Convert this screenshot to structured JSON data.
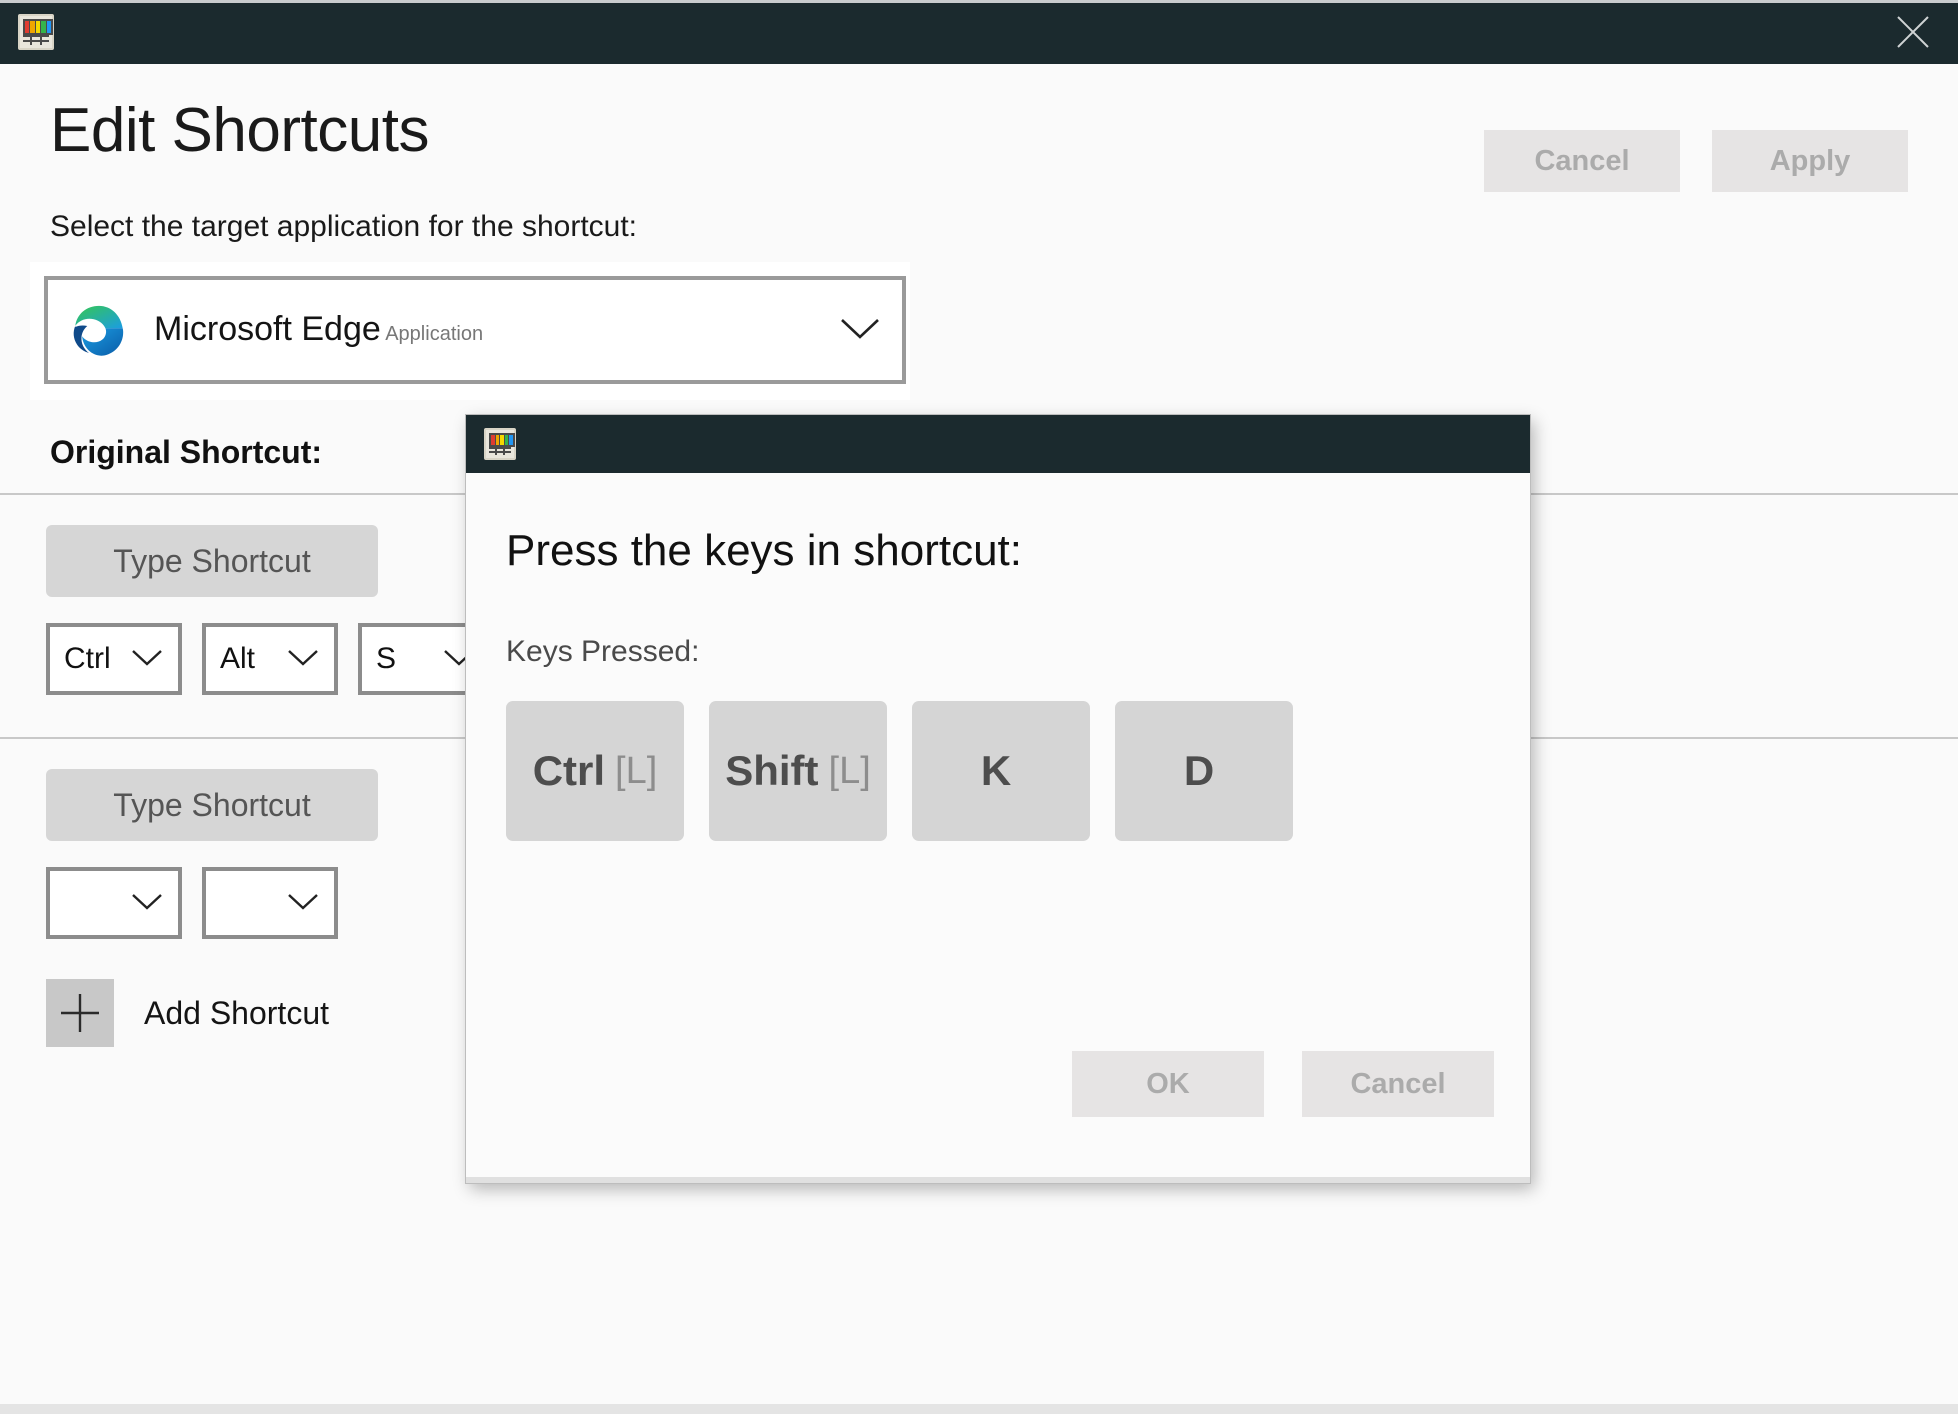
{
  "window": {
    "titlebar_color": "#1b2a2e",
    "app_icon": "powertoys-keyboard-manager-icon",
    "close_icon": "close-icon"
  },
  "header": {
    "title": "Edit Shortcuts",
    "cancel_label": "Cancel",
    "apply_label": "Apply",
    "buttons_disabled": true
  },
  "target_app": {
    "prompt": "Select the target application for the shortcut:",
    "selected_name": "Microsoft Edge",
    "selected_type": "Application",
    "icon": "microsoft-edge-icon",
    "chevron": "chevron-down-icon"
  },
  "shortcuts_section": {
    "heading": "Original Shortcut:"
  },
  "shortcut_rows": [
    {
      "type_shortcut_label": "Type Shortcut",
      "dropdowns": [
        {
          "value": "Ctrl"
        },
        {
          "value": "Alt"
        },
        {
          "value": "S"
        }
      ]
    },
    {
      "type_shortcut_label": "Type Shortcut",
      "dropdowns": [
        {
          "value": ""
        },
        {
          "value": ""
        }
      ]
    }
  ],
  "add_shortcut": {
    "label": "Add Shortcut",
    "icon": "plus-icon"
  },
  "dialog": {
    "title": "Press the keys in shortcut:",
    "keys_label": "Keys Pressed:",
    "app_icon": "powertoys-keyboard-manager-icon",
    "keys": [
      {
        "main": "Ctrl",
        "side": "[L]"
      },
      {
        "main": "Shift",
        "side": "[L]"
      },
      {
        "main": "K",
        "side": ""
      },
      {
        "main": "D",
        "side": ""
      }
    ],
    "ok_label": "OK",
    "cancel_label": "Cancel",
    "buttons_disabled": true
  },
  "colors": {
    "titlebar": "#1b2a2e",
    "page_background": "#fafafa",
    "disabled_button_bg": "#e6e4e4",
    "disabled_button_text": "#ababab",
    "key_chip_bg": "#d5d5d5",
    "separator": "#c8c8c8"
  }
}
